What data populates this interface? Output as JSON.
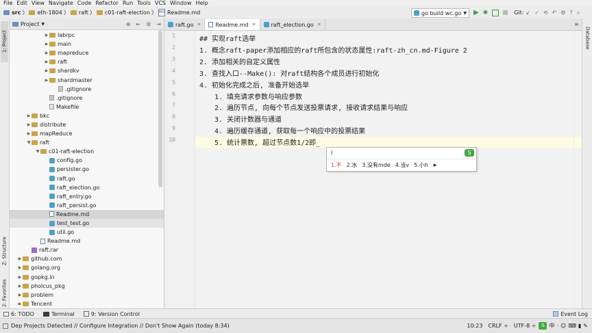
{
  "menu": [
    "File",
    "Edit",
    "View",
    "Navigate",
    "Code",
    "Refactor",
    "Run",
    "Tools",
    "VCS",
    "Window",
    "Help"
  ],
  "breadcrumb": [
    "src",
    "eth-1804",
    "raft",
    "c01-raft-election",
    "Readme.md"
  ],
  "run_config": "go build wc.go",
  "vcs_label": "Git:",
  "side_tabs": {
    "project": "1: Project",
    "structure": "Z: Structure",
    "favorites": "2: Favorites",
    "database": "Database"
  },
  "project_panel": {
    "title": "Project"
  },
  "tree": [
    {
      "label": "labrpc",
      "kind": "folder",
      "indent": 3,
      "arrow": "right"
    },
    {
      "label": "main",
      "kind": "folder",
      "indent": 3,
      "arrow": "right"
    },
    {
      "label": "mapreduce",
      "kind": "folder",
      "indent": 3,
      "arrow": "right"
    },
    {
      "label": "raft",
      "kind": "folder",
      "indent": 3,
      "arrow": "right"
    },
    {
      "label": "shardkv",
      "kind": "folder",
      "indent": 3,
      "arrow": "right"
    },
    {
      "label": "shardmaster",
      "kind": "folder",
      "indent": 3,
      "arrow": "right"
    },
    {
      "label": ".gitignore",
      "kind": "git",
      "indent": 4,
      "arrow": ""
    },
    {
      "label": ".gitignore",
      "kind": "git",
      "indent": 3,
      "arrow": ""
    },
    {
      "label": "Makefile",
      "kind": "make",
      "indent": 3,
      "arrow": ""
    },
    {
      "label": "bkc",
      "kind": "folder",
      "indent": 1,
      "arrow": "right"
    },
    {
      "label": "distribute",
      "kind": "folder",
      "indent": 1,
      "arrow": "right"
    },
    {
      "label": "mapReduce",
      "kind": "folder",
      "indent": 1,
      "arrow": "right"
    },
    {
      "label": "raft",
      "kind": "folder",
      "indent": 1,
      "arrow": "down"
    },
    {
      "label": "c01-raft-election",
      "kind": "folder",
      "indent": 2,
      "arrow": "down"
    },
    {
      "label": "config.go",
      "kind": "go",
      "indent": 3,
      "arrow": ""
    },
    {
      "label": "persister.go",
      "kind": "go",
      "indent": 3,
      "arrow": ""
    },
    {
      "label": "raft.go",
      "kind": "go",
      "indent": 3,
      "arrow": ""
    },
    {
      "label": "raft_election.go",
      "kind": "go",
      "indent": 3,
      "arrow": ""
    },
    {
      "label": "raft_entry.go",
      "kind": "go",
      "indent": 3,
      "arrow": ""
    },
    {
      "label": "raft_persist.go",
      "kind": "go",
      "indent": 3,
      "arrow": ""
    },
    {
      "label": "Readme.md",
      "kind": "md",
      "indent": 3,
      "arrow": "",
      "state": "selected"
    },
    {
      "label": "test_test.go",
      "kind": "go",
      "indent": 3,
      "arrow": "",
      "state": "hover"
    },
    {
      "label": "util.go",
      "kind": "go",
      "indent": 3,
      "arrow": ""
    },
    {
      "label": "Readme.md",
      "kind": "md",
      "indent": 2,
      "arrow": ""
    },
    {
      "label": "raft.rar",
      "kind": "rar",
      "indent": 1,
      "arrow": ""
    },
    {
      "label": "github.com",
      "kind": "folder",
      "indent": 0,
      "arrow": "right"
    },
    {
      "label": "golang.org",
      "kind": "folder",
      "indent": 0,
      "arrow": "right"
    },
    {
      "label": "gopkg.in",
      "kind": "folder",
      "indent": 0,
      "arrow": "right"
    },
    {
      "label": "pholcus_pkg",
      "kind": "folder",
      "indent": 0,
      "arrow": "right"
    },
    {
      "label": "problem",
      "kind": "folder",
      "indent": 0,
      "arrow": "right"
    },
    {
      "label": "Tencent",
      "kind": "folder",
      "indent": 0,
      "arrow": "right"
    }
  ],
  "editor_tabs": [
    {
      "label": "raft.go",
      "kind": "go",
      "active": false
    },
    {
      "label": "Readme.md",
      "kind": "md",
      "active": true
    },
    {
      "label": "raft_election.go",
      "kind": "go",
      "active": false
    }
  ],
  "code_lines": [
    {
      "n": "1",
      "text": "## 实现raft选举",
      "indent": 0
    },
    {
      "n": "2",
      "text": "1. 概念raft-paper添加相应的raft所包含的状态属性:raft-zh_cn.md-Figure 2",
      "indent": 0
    },
    {
      "n": "3",
      "text": "2. 添加相关的自定义属性",
      "indent": 0
    },
    {
      "n": "4",
      "text": "3. 查找入口--Make(): 对raft结构各个成员进行初始化",
      "indent": 0
    },
    {
      "n": "5",
      "text": "4. 初始化完成之后, 准备开始选举",
      "indent": 0
    },
    {
      "n": "6",
      "text": "1. 填充请求参数与响应参数",
      "indent": 1
    },
    {
      "n": "7",
      "text": "2. 遍历节点, 向每个节点发送投票请求, 接收请求结果与响应",
      "indent": 1
    },
    {
      "n": "8",
      "text": "3. 关闭计数器与通道",
      "indent": 1
    },
    {
      "n": "9",
      "text": "4. 遍历缓存通道, 获取每一个响应中的投票结果",
      "indent": 1
    },
    {
      "n": "10",
      "text": "5. 统计票数, 超过节点数1/2即_",
      "indent": 1
    }
  ],
  "ime": {
    "composition": "l",
    "candidates": [
      "1.不",
      "2.水",
      "3.没有mde",
      "4.当v",
      "5.小h"
    ]
  },
  "tool_tabs": [
    "6: TODO",
    "Terminal",
    "9: Version Control"
  ],
  "event_log": "Event Log",
  "status": {
    "message": "Dep Projects Detected // Configure Integration // Don't Show Again (today 8:34)",
    "position": "10:23",
    "line_sep": "CRLF ÷",
    "encoding": "UTF-8 ÷"
  },
  "colors": {
    "accent_green": "#3c9c3c",
    "ime_red": "#d83b3b",
    "selection": "#d5d5d5",
    "current_line": "#fdfbe1"
  }
}
